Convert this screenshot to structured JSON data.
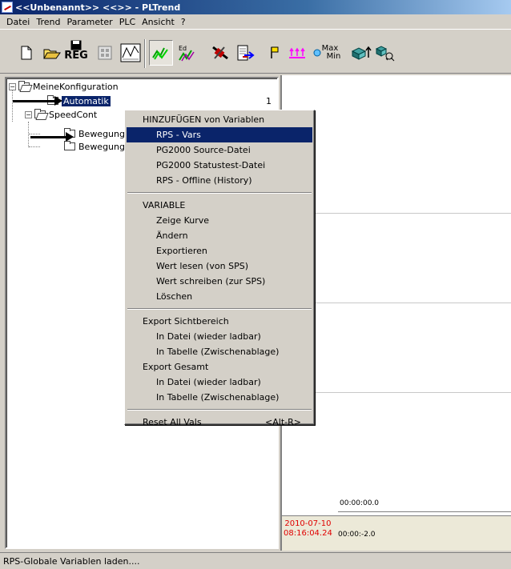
{
  "window": {
    "title": "<<Unbenannt>> <<>> - PLTrend"
  },
  "menubar": {
    "items": [
      "Datei",
      "Trend",
      "Parameter",
      "PLC",
      "Ansicht",
      "?"
    ]
  },
  "toolbar": {
    "reg_label": "REG",
    "max_label": "Max",
    "min_label": "Min",
    "icons": [
      "new-icon",
      "open-icon",
      "save-reg-icon",
      "config-icon",
      "trend-view-icon",
      "trend-active-icon",
      "edit-trend-icon",
      "plc-connect-icon",
      "export-icon",
      "flag-icon",
      "scale-icon",
      "max-min-icon",
      "zoom-icon",
      "zoom-fit-icon"
    ]
  },
  "tree": {
    "root": "MeineKonfiguration",
    "items": [
      {
        "label": "Automatik",
        "count": "1"
      },
      {
        "label": "SpeedCont"
      },
      {
        "label": "Bewegung"
      },
      {
        "label": "Bewegung"
      }
    ]
  },
  "chart": {
    "time_top": "00:00:00.0",
    "time_bottom": "00:00:-2.0",
    "date": "2010-07-10",
    "time": "08:16:04.24"
  },
  "context_menu": {
    "section_add": "HINZUFÜGEN von Variablen",
    "add_items": [
      "RPS - Vars",
      "PG2000 Source-Datei",
      "PG2000 Statustest-Datei",
      "RPS - Offline (History)"
    ],
    "section_variable": "VARIABLE",
    "variable_items": [
      "Zeige Kurve",
      "Ändern",
      "Exportieren",
      "Wert lesen (von SPS)",
      "Wert schreiben (zur SPS)",
      "Löschen"
    ],
    "section_export_view": "Export Sichtbereich",
    "export_view_items": [
      "In Datei (wieder ladbar)",
      "In Tabelle (Zwischenablage)"
    ],
    "section_export_all": "Export Gesamt",
    "export_all_items": [
      "In Datei (wieder ladbar)",
      "In Tabelle (Zwischenablage)"
    ],
    "reset": "Reset All Vals",
    "reset_shortcut": "<Alt-R>"
  },
  "statusbar": {
    "text": "RPS-Globale Variablen laden...."
  },
  "colors": {
    "selection": "#0a246a",
    "date_text": "#e00000",
    "chrome": "#d4d0c8"
  }
}
